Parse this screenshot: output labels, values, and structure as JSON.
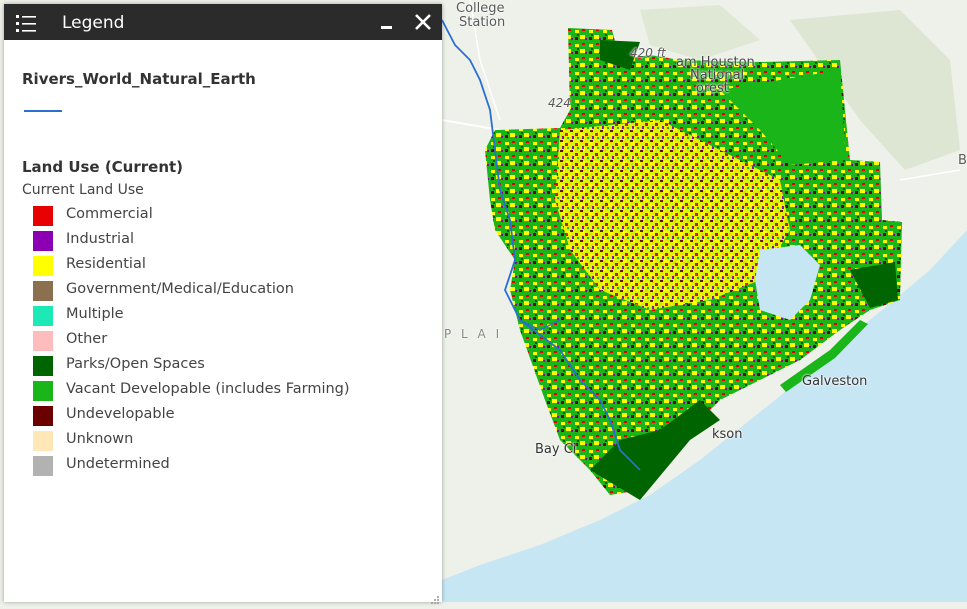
{
  "legend_panel": {
    "title": "Legend",
    "icons": {
      "menu": "legend-list-icon",
      "minimize": "minimize-icon",
      "close": "close-icon"
    },
    "rivers_layer": {
      "title": "Rivers_World_Natural_Earth",
      "line_color": "#2a6fd1"
    },
    "land_use_layer": {
      "title": "Land Use (Current)",
      "subtitle": "Current Land Use",
      "items": [
        {
          "label": "Commercial",
          "color": "#e60000"
        },
        {
          "label": "Industrial",
          "color": "#8c00b4"
        },
        {
          "label": "Residential",
          "color": "#ffff00"
        },
        {
          "label": "Government/Medical/Education",
          "color": "#8b6f4e"
        },
        {
          "label": "Multiple",
          "color": "#1de9b6"
        },
        {
          "label": "Other",
          "color": "#ffbcbc"
        },
        {
          "label": "Parks/Open Spaces",
          "color": "#006400"
        },
        {
          "label": "Vacant Developable (includes Farming)",
          "color": "#19b519"
        },
        {
          "label": "Undevelopable",
          "color": "#6b0000"
        },
        {
          "label": "Unknown",
          "color": "#ffe7b8"
        },
        {
          "label": "Undetermined",
          "color": "#b2b2b2"
        }
      ]
    }
  },
  "map_labels": {
    "college_station_1": "College",
    "college_station_2": "Station",
    "sam_houston_1": "am Houston",
    "sam_houston_2": "National",
    "sam_houston_3": "orest",
    "highway_424": "424",
    "highway_420": "420 ft",
    "plain": "P L A I",
    "galveston": "Galveston",
    "bay_city": "Bay Ci",
    "lake_jackson": "kson",
    "edge_b": "B"
  },
  "colors": {
    "sea": "#c7e6f3",
    "land": "#eef0ea"
  }
}
